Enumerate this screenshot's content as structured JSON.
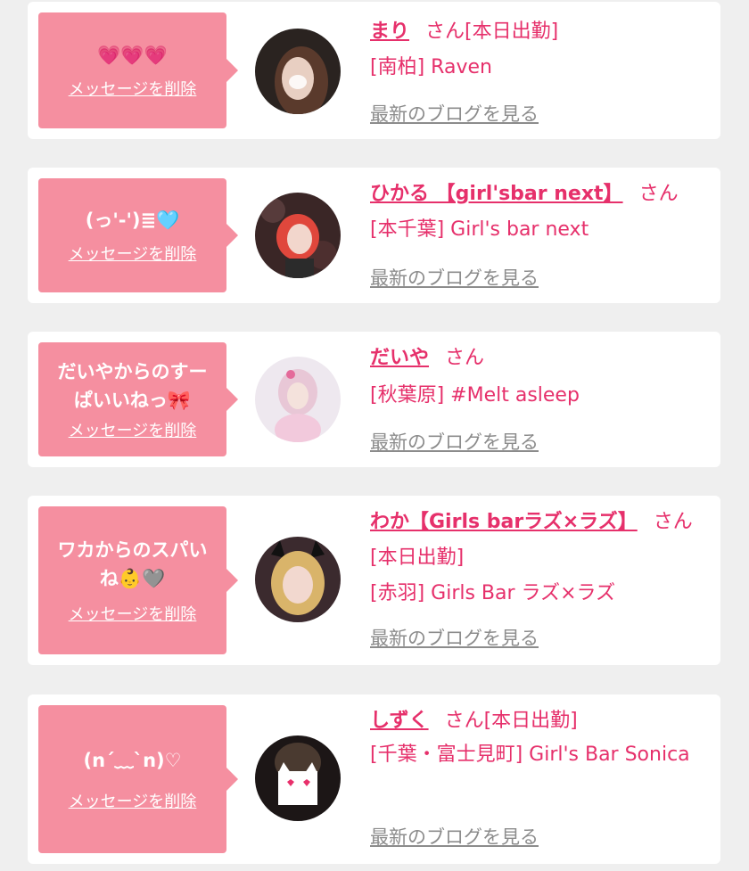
{
  "delete_label": "メッセージを削除",
  "blog_label": "最新のブログを見る",
  "san_label": "さん",
  "colors": {
    "accent": "#e6306b",
    "bubble": "#f58fa0",
    "link_gray": "#8c8c8c"
  },
  "cards": [
    {
      "message_lines": [
        "💗💗💗"
      ],
      "name": "まり",
      "status": "[本日出勤]",
      "shop": "[南柏] Raven"
    },
    {
      "message_lines": [
        "(っ'-')≣🩵"
      ],
      "name": "ひかる 【girl'sbar next】",
      "status": "",
      "shop": "[本千葉] Girl's bar next"
    },
    {
      "message_lines": [
        "だいやからのすー",
        "ぱいいねっ🎀"
      ],
      "name": "だいや",
      "status": "",
      "shop": "[秋葉原] #Melt asleep"
    },
    {
      "message_lines": [
        "ワカからのスパい",
        "ね👶🩶"
      ],
      "name": "わか【Girls barラズ×ラズ】",
      "status": "[本日出勤]",
      "shop": "[赤羽] Girls Bar ラズ×ラズ"
    },
    {
      "message_lines": [
        "(n´﹏`n)♡"
      ],
      "name": "しずく",
      "status": "[本日出勤]",
      "shop": "[千葉・富士見町] Girl's Bar Sonica"
    }
  ]
}
